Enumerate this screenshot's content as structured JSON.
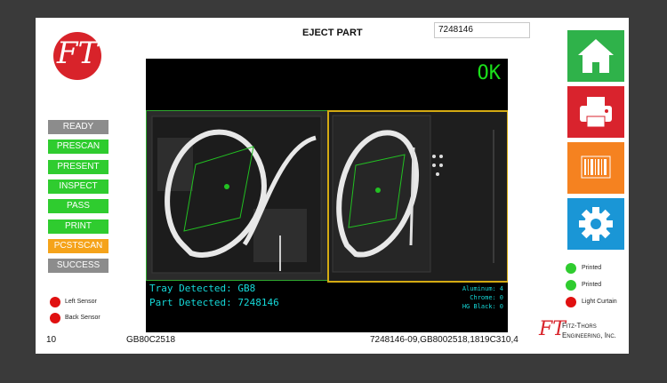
{
  "header": {
    "title": "EJECT PART",
    "part_field_value": "7248146"
  },
  "logo": {
    "text": "FT",
    "bg": "#d8232a"
  },
  "steps": [
    {
      "label": "READY",
      "color": "#8c8c8c"
    },
    {
      "label": "PRESCAN",
      "color": "#2fcc2f"
    },
    {
      "label": "PRESENT",
      "color": "#2fcc2f"
    },
    {
      "label": "INSPECT",
      "color": "#2fcc2f"
    },
    {
      "label": "PASS",
      "color": "#2fcc2f"
    },
    {
      "label": "PRINT",
      "color": "#2fcc2f"
    },
    {
      "label": "PCSTSCAN",
      "color": "#f5a31a"
    },
    {
      "label": "SUCCESS",
      "color": "#8c8c8c"
    }
  ],
  "sensors": [
    {
      "label": "Left Sensor",
      "color": "#e01010"
    },
    {
      "label": "Back Sensor",
      "color": "#e01010"
    }
  ],
  "camera": {
    "result": "OK",
    "overlay": {
      "tray_label": "Tray Detected:",
      "tray_value": "GB8",
      "part_label": "Part Detected:",
      "part_value": "7248146",
      "metrics": [
        {
          "label": "Aluminum:",
          "value": "4"
        },
        {
          "label": "Chrome:",
          "value": "0"
        },
        {
          "label": "HG Black:",
          "value": "0"
        }
      ]
    }
  },
  "tiles": [
    {
      "name": "home",
      "icon": "home-icon",
      "color": "#2fb24a"
    },
    {
      "name": "print",
      "icon": "printer-icon",
      "color": "#d9232d"
    },
    {
      "name": "barcode",
      "icon": "barcode-icon",
      "color": "#f58220"
    },
    {
      "name": "settings",
      "icon": "gear-icon",
      "color": "#1a96d6"
    }
  ],
  "indicators": [
    {
      "label": "Printed",
      "color": "#2fcc2f"
    },
    {
      "label": "Printed",
      "color": "#2fcc2f"
    },
    {
      "label": "Light Curtain",
      "color": "#e01010"
    }
  ],
  "footer": {
    "count": "10",
    "tray_code": "GB80C2518",
    "scan_string": "7248146-09,GB8002518,1819C310,4",
    "company_line1": "Fitz-Thors",
    "company_line2": "Engineering, Inc."
  }
}
